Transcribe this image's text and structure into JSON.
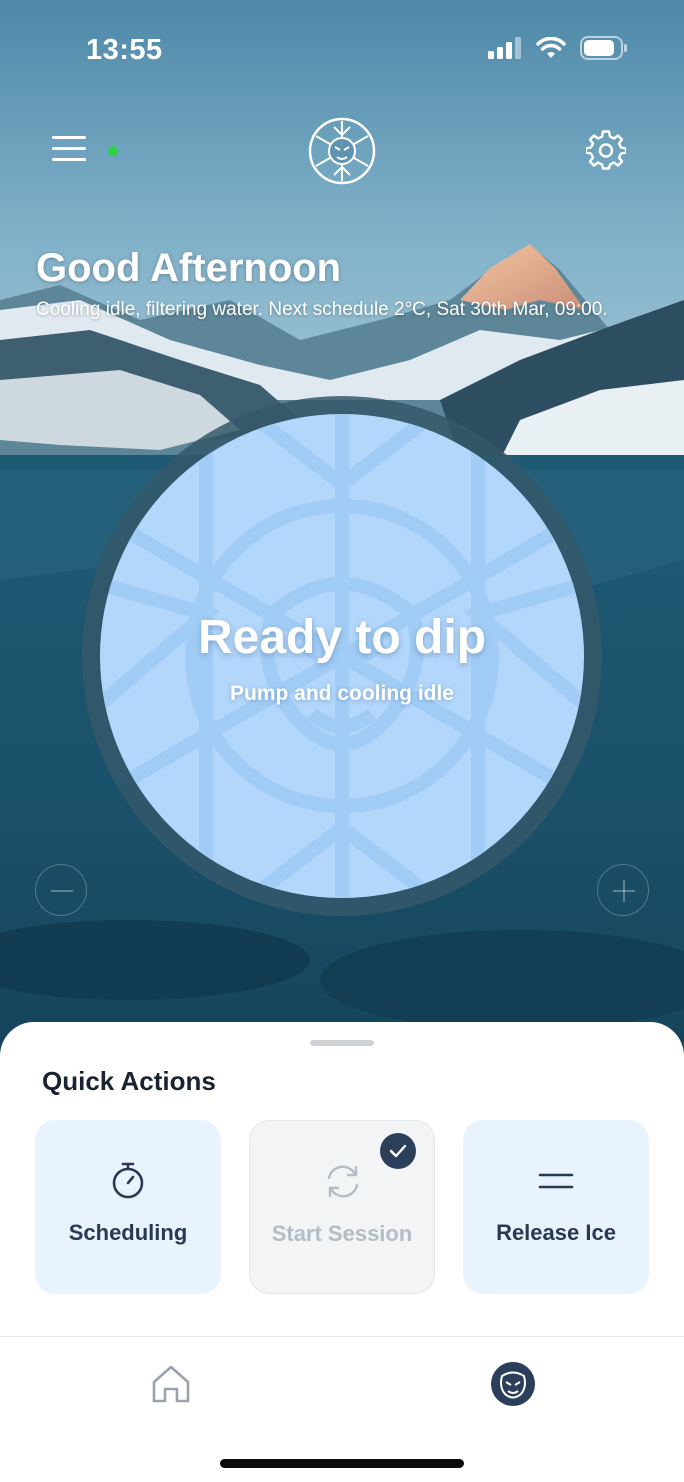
{
  "status_bar": {
    "time": "13:55",
    "signal_icon": "cellular-signal-icon",
    "wifi_icon": "wifi-icon",
    "battery_icon": "battery-icon"
  },
  "header": {
    "menu_icon": "hamburger-menu-icon",
    "connection_status_color": "#2ed04a",
    "logo_icon": "brand-logo-icon",
    "settings_icon": "gear-icon"
  },
  "greeting": {
    "title": "Good Afternoon",
    "subtitle": "Cooling idle, filtering water. Next schedule 2°C, Sat 30th Mar, 09:00."
  },
  "dial": {
    "title": "Ready to dip",
    "subtitle": "Pump and cooling idle",
    "fill_color": "#b3d6fb"
  },
  "controls": {
    "decrease_icon": "minus-icon",
    "increase_icon": "plus-icon"
  },
  "quick_actions": {
    "title": "Quick Actions",
    "items": [
      {
        "label": "Scheduling",
        "icon": "stopwatch-icon",
        "state": "enabled"
      },
      {
        "label": "Start Session",
        "icon": "refresh-icon",
        "state": "disabled",
        "badge": "check-icon"
      },
      {
        "label": "Release Ice",
        "icon": "equals-icon",
        "state": "enabled"
      }
    ]
  },
  "tabbar": {
    "tabs": [
      {
        "icon": "home-icon"
      },
      {
        "icon": "brand-logo-icon",
        "active": true
      }
    ]
  },
  "colors": {
    "accent_dark": "#2c3f5a",
    "card_bg": "#e9f3fe",
    "online": "#2ed04a"
  }
}
